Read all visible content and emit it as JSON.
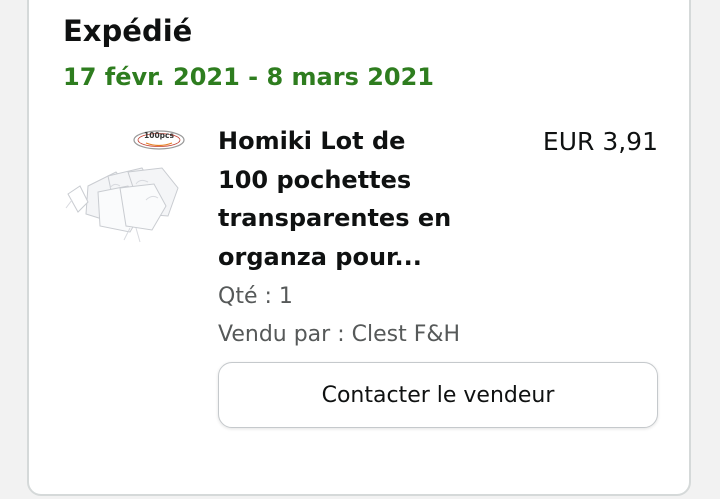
{
  "shipment": {
    "status": "Expédié",
    "date_range": "17 févr. 2021 - 8 mars 2021"
  },
  "item": {
    "title": "Homiki Lot de 100 pochettes transparentes en organza pour...",
    "price": "EUR 3,91",
    "quantity": "Qté : 1",
    "sold_by": "Vendu par : Clest F&H",
    "image_badge": "100pcs",
    "image": "white-organza-bags-product-thumbnail"
  },
  "actions": {
    "contact_seller_label": "Contacter le vendeur"
  },
  "colors": {
    "date_green": "#2e7d1f",
    "text": "#0f1111",
    "secondary_text": "#565959",
    "border": "#d5d9d9"
  }
}
